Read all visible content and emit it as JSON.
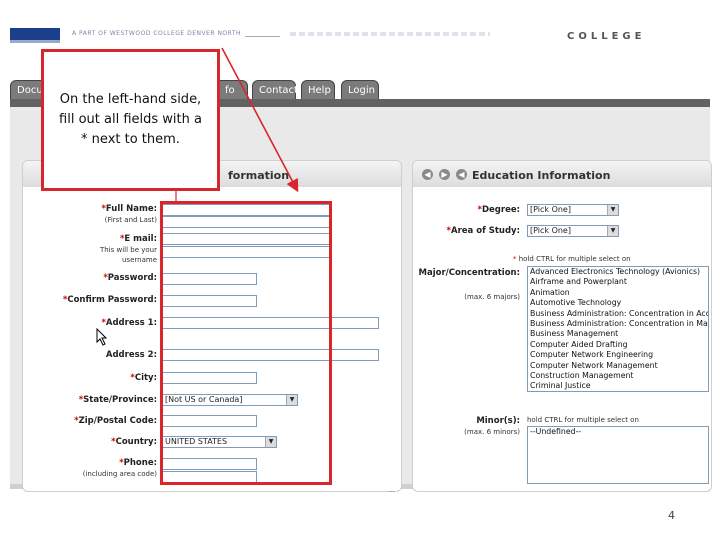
{
  "header": {
    "tagline": "A PART OF WESTWOOD COLLEGE DENVER NORTH",
    "college": "COLLEGE"
  },
  "tabs": [
    {
      "label": "Docu"
    },
    {
      "label": "fo"
    },
    {
      "label": "Contact"
    },
    {
      "label": "Help"
    },
    {
      "label": "Login"
    }
  ],
  "left_panel": {
    "title": "formation",
    "fields": {
      "full_name": {
        "label": "Full Name:",
        "sub": "(First and Last)"
      },
      "email": {
        "label": "E mail:",
        "sub1": "This will be your",
        "sub2": "username"
      },
      "password": {
        "label": "Password:"
      },
      "confirm_password": {
        "label": "Confirm Password:"
      },
      "address1": {
        "label": "Address 1:"
      },
      "address2": {
        "label": "Address 2:"
      },
      "city": {
        "label": "City:"
      },
      "state": {
        "label": "State/Province:",
        "value": "[Not US or Canada]"
      },
      "zip": {
        "label": "Zip/Postal Code:"
      },
      "country": {
        "label": "Country:",
        "value": "UNITED STATES"
      },
      "phone": {
        "label": "Phone:",
        "sub": "(including area code)"
      }
    }
  },
  "right_panel": {
    "title": "Education Information",
    "degree": {
      "label": "Degree:",
      "value": "[Pick One]"
    },
    "area": {
      "label": "Area of Study:",
      "value": "[Pick One]"
    },
    "hold_ctrl_1": "hold CTRL for multiple select on",
    "major": {
      "label": "Major/Concentration:",
      "sub": "(max. 6 majors)"
    },
    "majors": [
      "Advanced Electronics Technology (Avionics)",
      "Airframe and Powerplant",
      "Animation",
      "Automotive Technology",
      "Business Administration: Concentration in Acco",
      "Business Administration: Concentration in Mar",
      "Business Management",
      "Computer Aided Drafting",
      "Computer Network Engineering",
      "Computer Network Management",
      "Construction Management",
      "Criminal Justice"
    ],
    "minor": {
      "label": "Minor(s):",
      "sub": "(max. 6 minors)",
      "value": "--Undefined--"
    },
    "hold_ctrl_2": "hold CTRL for multiple select on"
  },
  "annotation": {
    "line1": "On the left-hand side,",
    "line2": "fill out all fields with a",
    "line3": "* next to them."
  },
  "footer": {
    "dots": "...",
    "page_number": "4"
  },
  "colors": {
    "annotation_red": "#d9262c",
    "tab_gray": "#7b7b7b",
    "logo_blue": "#1b3f8a"
  }
}
